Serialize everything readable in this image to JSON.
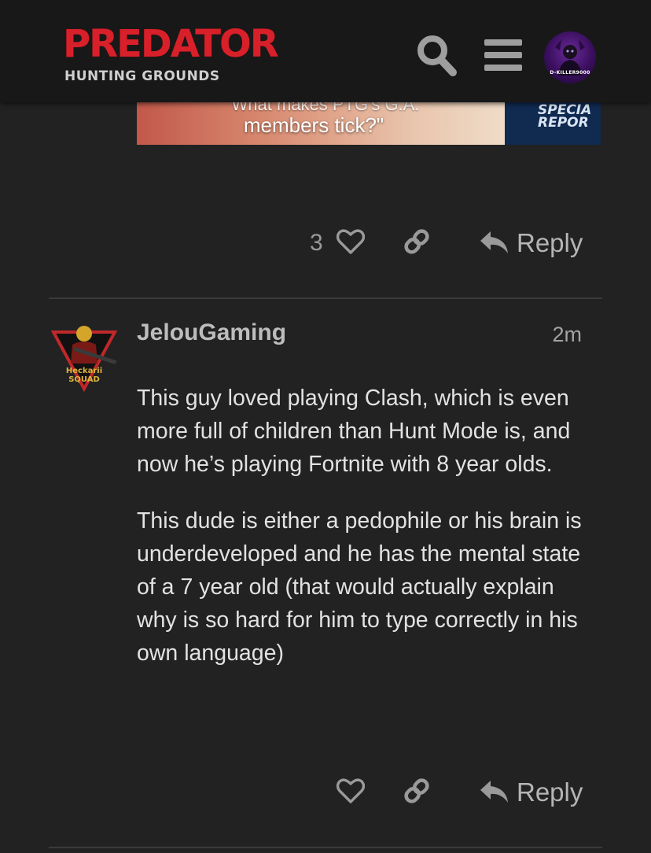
{
  "header": {
    "logo_title": "PREDATOR",
    "logo_subtitle": "HUNTING GROUNDS",
    "avatar_text": "D-KILLER9000"
  },
  "colors": {
    "background": "#222222",
    "header_bg": "#181818",
    "logo_red": "#d8202a",
    "text_primary": "#e2e2e2",
    "text_muted": "#a3a3a3",
    "divider": "#3a3a3a"
  },
  "embed": {
    "caption_cut": "What makes PTG's G.A.",
    "caption": "members tick?\"",
    "badge_line1": "SPECIA",
    "badge_line2": "REPOR"
  },
  "post1": {
    "like_count": "3",
    "reply_label": "Reply"
  },
  "post2": {
    "username": "JelouGaming",
    "time": "2m",
    "avatar_text_top": "Heckarii",
    "avatar_text_bottom": "SQUAD",
    "paragraphs": [
      "This guy loved playing Clash, which is even more full of children than Hunt Mode is, and now he’s playing Fortnite with 8 year olds.",
      "This dude is either a pedophile or his brain is underdeveloped and he has the mental state of a 7 year old (that would actually explain why is so hard for him to type correctly in his own language)"
    ],
    "reply_label": "Reply"
  },
  "icons": [
    "search-icon",
    "hamburger-menu-icon",
    "heart-icon",
    "link-icon",
    "reply-arrow-icon"
  ]
}
